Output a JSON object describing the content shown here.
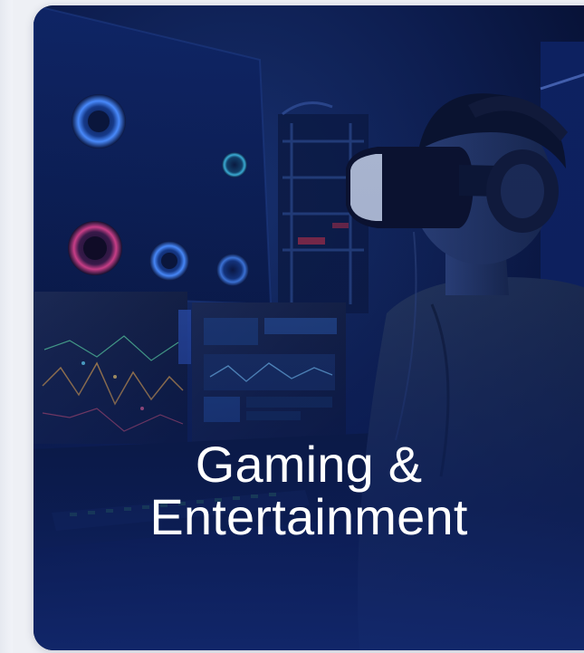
{
  "card": {
    "title_line1": "Gaming &",
    "title_line2": "Entertainment"
  },
  "image": {
    "subject": "person-wearing-vr-headset-with-gaming-monitors"
  },
  "colors": {
    "background": "#eef0f5",
    "card_dark": "#0b1a47",
    "card_gradient_bottom": "#1a2f7a",
    "text": "#ffffff"
  }
}
